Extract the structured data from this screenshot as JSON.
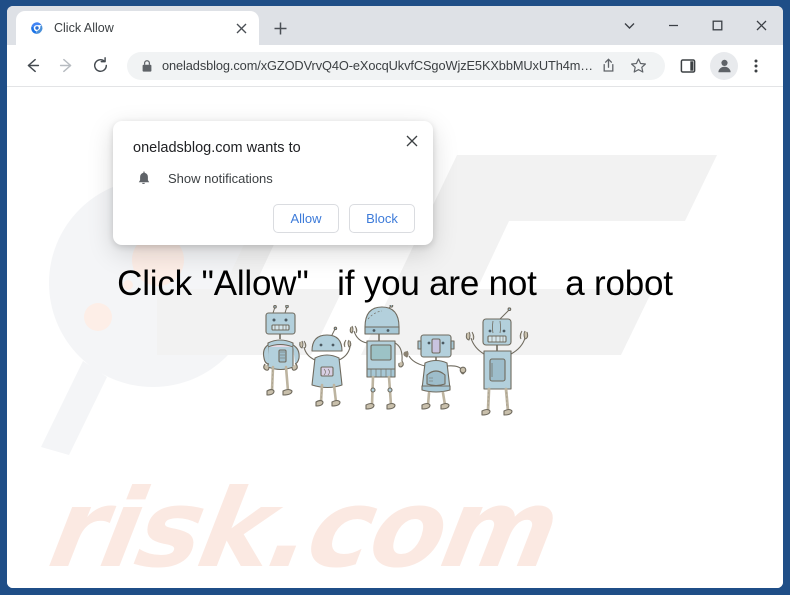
{
  "window": {
    "controls": [
      {
        "name": "tab-search-chevron",
        "glyph": "chevron-down-icon"
      },
      {
        "name": "minimize",
        "glyph": "minimize-icon"
      },
      {
        "name": "maximize",
        "glyph": "maximize-icon"
      },
      {
        "name": "close",
        "glyph": "close-icon"
      }
    ]
  },
  "tab": {
    "title": "Click Allow",
    "favicon": "blue-circular-arrow-favicon",
    "close_label": "×",
    "newtab_label": "+"
  },
  "toolbar": {
    "back": "back-arrow-icon",
    "forward": "forward-arrow-icon",
    "reload": "reload-icon",
    "lock": "lock-icon",
    "url": "oneladsblog.com/xGZODVrvQ4O-eXocqUkvfCSgoWjzE5KXbbMUxUTh4m…",
    "share": "share-icon",
    "bookmark": "star-icon",
    "side_panel": "side-panel-icon",
    "profile": "profile-avatar-icon",
    "menu": "three-dot-menu-icon"
  },
  "dialog": {
    "title": "oneladsblog.com wants to",
    "permission_icon": "bell-icon",
    "permission_label": "Show notifications",
    "allow_label": "Allow",
    "block_label": "Block",
    "close_label": "×",
    "accent_color": "#3d7bd9"
  },
  "page": {
    "headline": "Click \"Allow\"   if you are not   a robot",
    "illustration": "five-cartoon-robots",
    "watermark_text": "risk.com",
    "watermark_logo": "pcrisk-pc-monogram",
    "watermark_color": "#fbe9e2",
    "watermark_logo_color": "#f2f2f2"
  }
}
